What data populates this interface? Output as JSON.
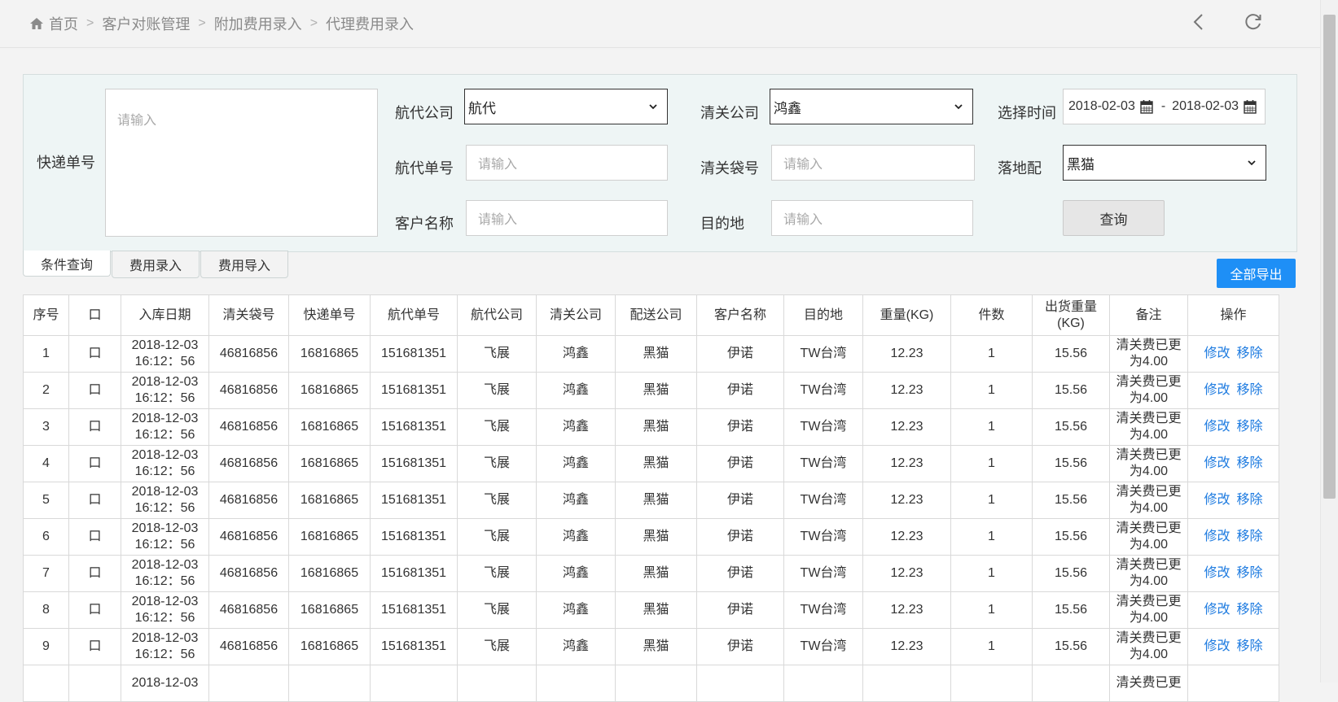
{
  "breadcrumb": {
    "items": [
      "首页",
      "客户对账管理",
      "附加费用录入",
      "代理费用录入"
    ]
  },
  "search": {
    "express_label": "快递单号",
    "express_placeholder": "请输入",
    "airline_label": "航代公司",
    "airline_value": "航代",
    "clearance_label": "清关公司",
    "clearance_value": "鸿鑫",
    "time_label": "选择时间",
    "date_start": "2018-02-03",
    "date_sep": "-",
    "date_end": "2018-02-03",
    "airline_no_label": "航代单号",
    "airline_no_placeholder": "请输入",
    "bag_label": "清关袋号",
    "bag_placeholder": "请输入",
    "delivery_label": "落地配",
    "delivery_value": "黑猫",
    "customer_label": "客户名称",
    "customer_placeholder": "请输入",
    "dest_label": "目的地",
    "dest_placeholder": "请输入",
    "query_button": "查询"
  },
  "tabs": [
    "条件查询",
    "费用录入",
    "费用导入"
  ],
  "export_button": "全部导出",
  "table": {
    "headers": [
      "序号",
      "口",
      "入库日期",
      "清关袋号",
      "快递单号",
      "航代单号",
      "航代公司",
      "清关公司",
      "配送公司",
      "客户名称",
      "目的地",
      "重量(KG)",
      "件数",
      "出货重量(KG)",
      "备注",
      "操作"
    ],
    "edit_label": "修改",
    "remove_label": "移除",
    "rows": [
      {
        "no": "1",
        "chk": "口",
        "date": "2018-12-03",
        "time": "16:12：56",
        "bag": "46816856",
        "express": "16816865",
        "airline_no": "151681351",
        "airline": "飞展",
        "clearance": "鸿鑫",
        "delivery": "黑猫",
        "customer": "伊诺",
        "dest": "TW台湾",
        "weight": "12.23",
        "count": "1",
        "out_weight": "15.56",
        "note1": "清关费已更",
        "note2": "为4.00"
      },
      {
        "no": "2",
        "chk": "口",
        "date": "2018-12-03",
        "time": "16:12：56",
        "bag": "46816856",
        "express": "16816865",
        "airline_no": "151681351",
        "airline": "飞展",
        "clearance": "鸿鑫",
        "delivery": "黑猫",
        "customer": "伊诺",
        "dest": "TW台湾",
        "weight": "12.23",
        "count": "1",
        "out_weight": "15.56",
        "note1": "清关费已更",
        "note2": "为4.00"
      },
      {
        "no": "3",
        "chk": "口",
        "date": "2018-12-03",
        "time": "16:12：56",
        "bag": "46816856",
        "express": "16816865",
        "airline_no": "151681351",
        "airline": "飞展",
        "clearance": "鸿鑫",
        "delivery": "黑猫",
        "customer": "伊诺",
        "dest": "TW台湾",
        "weight": "12.23",
        "count": "1",
        "out_weight": "15.56",
        "note1": "清关费已更",
        "note2": "为4.00"
      },
      {
        "no": "4",
        "chk": "口",
        "date": "2018-12-03",
        "time": "16:12：56",
        "bag": "46816856",
        "express": "16816865",
        "airline_no": "151681351",
        "airline": "飞展",
        "clearance": "鸿鑫",
        "delivery": "黑猫",
        "customer": "伊诺",
        "dest": "TW台湾",
        "weight": "12.23",
        "count": "1",
        "out_weight": "15.56",
        "note1": "清关费已更",
        "note2": "为4.00"
      },
      {
        "no": "5",
        "chk": "口",
        "date": "2018-12-03",
        "time": "16:12：56",
        "bag": "46816856",
        "express": "16816865",
        "airline_no": "151681351",
        "airline": "飞展",
        "clearance": "鸿鑫",
        "delivery": "黑猫",
        "customer": "伊诺",
        "dest": "TW台湾",
        "weight": "12.23",
        "count": "1",
        "out_weight": "15.56",
        "note1": "清关费已更",
        "note2": "为4.00"
      },
      {
        "no": "6",
        "chk": "口",
        "date": "2018-12-03",
        "time": "16:12：56",
        "bag": "46816856",
        "express": "16816865",
        "airline_no": "151681351",
        "airline": "飞展",
        "clearance": "鸿鑫",
        "delivery": "黑猫",
        "customer": "伊诺",
        "dest": "TW台湾",
        "weight": "12.23",
        "count": "1",
        "out_weight": "15.56",
        "note1": "清关费已更",
        "note2": "为4.00"
      },
      {
        "no": "7",
        "chk": "口",
        "date": "2018-12-03",
        "time": "16:12：56",
        "bag": "46816856",
        "express": "16816865",
        "airline_no": "151681351",
        "airline": "飞展",
        "clearance": "鸿鑫",
        "delivery": "黑猫",
        "customer": "伊诺",
        "dest": "TW台湾",
        "weight": "12.23",
        "count": "1",
        "out_weight": "15.56",
        "note1": "清关费已更",
        "note2": "为4.00"
      },
      {
        "no": "8",
        "chk": "口",
        "date": "2018-12-03",
        "time": "16:12：56",
        "bag": "46816856",
        "express": "16816865",
        "airline_no": "151681351",
        "airline": "飞展",
        "clearance": "鸿鑫",
        "delivery": "黑猫",
        "customer": "伊诺",
        "dest": "TW台湾",
        "weight": "12.23",
        "count": "1",
        "out_weight": "15.56",
        "note1": "清关费已更",
        "note2": "为4.00"
      },
      {
        "no": "9",
        "chk": "口",
        "date": "2018-12-03",
        "time": "16:12：56",
        "bag": "46816856",
        "express": "16816865",
        "airline_no": "151681351",
        "airline": "飞展",
        "clearance": "鸿鑫",
        "delivery": "黑猫",
        "customer": "伊诺",
        "dest": "TW台湾",
        "weight": "12.23",
        "count": "1",
        "out_weight": "15.56",
        "note1": "清关费已更",
        "note2": "为4.00"
      },
      {
        "no": "",
        "chk": "",
        "date": "2018-12-03",
        "time": "",
        "bag": "",
        "express": "",
        "airline_no": "",
        "airline": "",
        "clearance": "",
        "delivery": "",
        "customer": "",
        "dest": "",
        "weight": "",
        "count": "",
        "out_weight": "",
        "note1": "清关费已更",
        "note2": ""
      }
    ]
  }
}
